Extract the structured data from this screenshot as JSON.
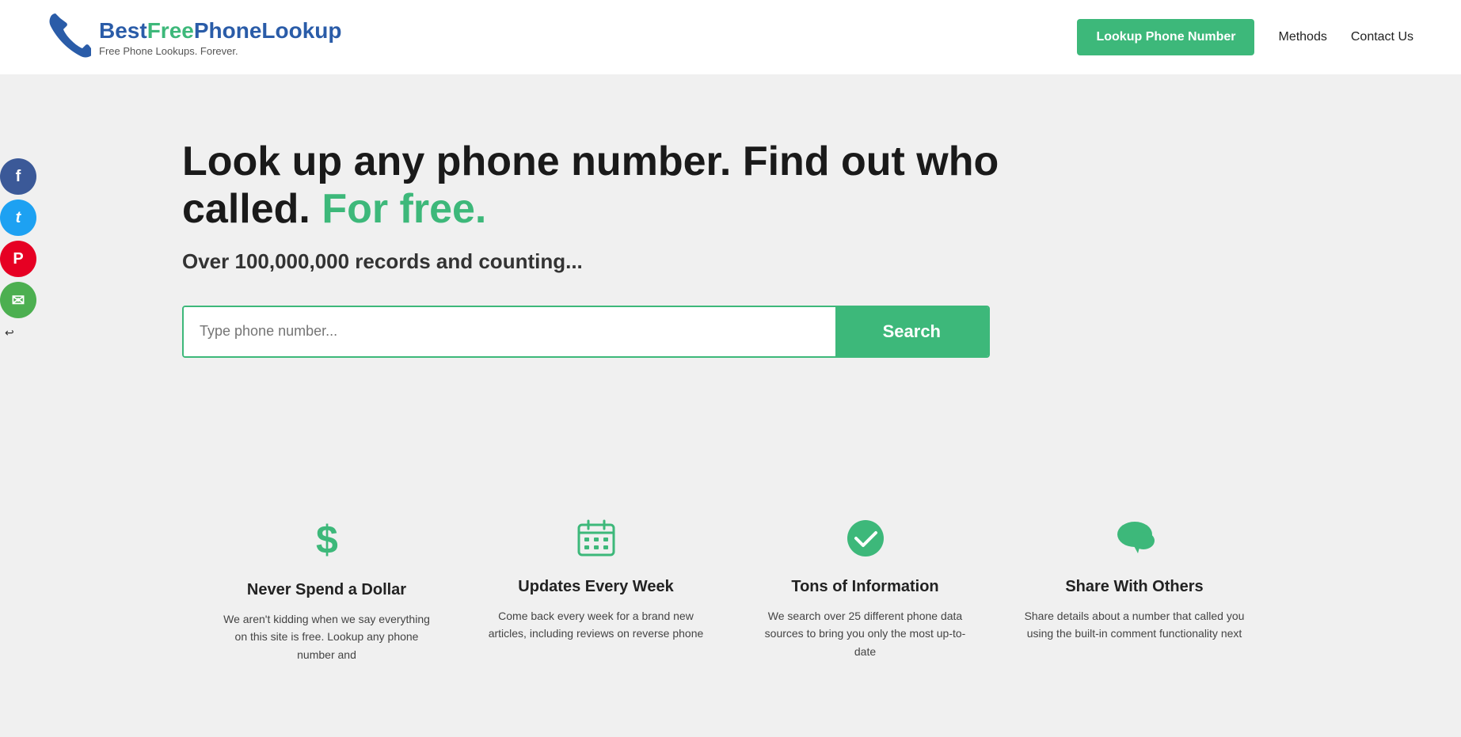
{
  "header": {
    "logo": {
      "title_best": "Best",
      "title_free": "Free",
      "title_phone": "Phone",
      "title_lookup": "Lookup",
      "subtitle": "Free Phone Lookups. Forever."
    },
    "nav": {
      "lookup_btn": "Lookup Phone Number",
      "methods_link": "Methods",
      "contact_link": "Contact Us"
    }
  },
  "social": {
    "facebook": "f",
    "twitter": "t",
    "pinterest": "p",
    "email": "✉",
    "arrow": "↩"
  },
  "hero": {
    "title_line1": "Look up any phone number. Find out who",
    "title_line2": "called.",
    "title_highlight": " For free.",
    "subtitle": "Over 100,000,000 records and counting...",
    "search_placeholder": "Type phone number...",
    "search_btn": "Search"
  },
  "features": [
    {
      "icon": "$",
      "title": "Never Spend a Dollar",
      "desc": "We aren't kidding when we say everything on this site is free. Lookup any phone number and"
    },
    {
      "icon": "📅",
      "title": "Updates Every Week",
      "desc": "Come back every week for a brand new articles, including reviews on reverse phone"
    },
    {
      "icon": "✔",
      "title": "Tons of Information",
      "desc": "We search over 25 different phone data sources to bring you only the most up-to-date"
    },
    {
      "icon": "💬",
      "title": "Share With Others",
      "desc": "Share details about a number that called you using the built-in comment functionality next"
    }
  ]
}
